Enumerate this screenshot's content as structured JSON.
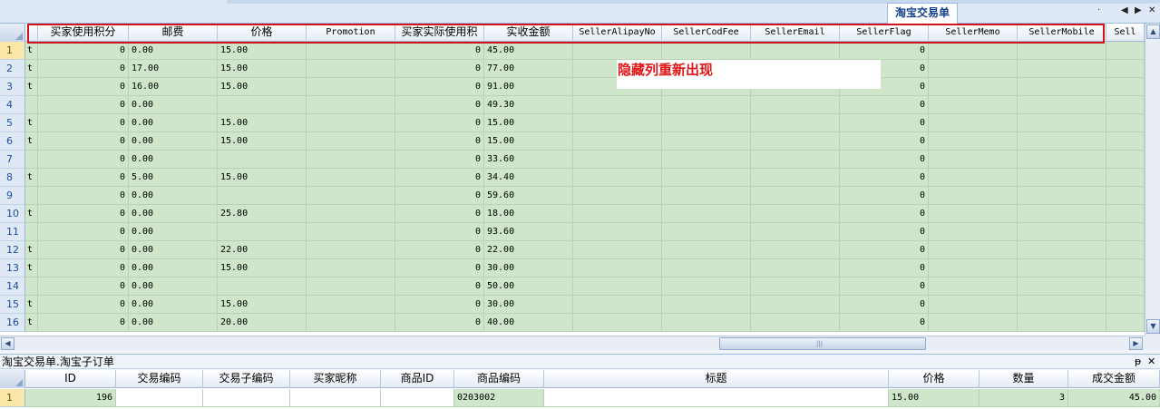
{
  "doc_tab": {
    "label": "淘宝交易单"
  },
  "main_grid": {
    "columns": [
      {
        "label": "买家使用积分",
        "kind": "cn"
      },
      {
        "label": "邮费",
        "kind": "cn"
      },
      {
        "label": "价格",
        "kind": "cn"
      },
      {
        "label": "Promotion",
        "kind": "en"
      },
      {
        "label": "买家实际使用积",
        "kind": "cn"
      },
      {
        "label": "实收金额",
        "kind": "cn"
      },
      {
        "label": "SellerAlipayNo",
        "kind": "en"
      },
      {
        "label": "SellerCodFee",
        "kind": "en"
      },
      {
        "label": "SellerEmail",
        "kind": "en"
      },
      {
        "label": "SellerFlag",
        "kind": "en"
      },
      {
        "label": "SellerMemo",
        "kind": "en"
      },
      {
        "label": "SellerMobile",
        "kind": "en"
      },
      {
        "label": "Sell",
        "kind": "en"
      }
    ],
    "rows": [
      {
        "num": "1",
        "flag": "t",
        "c": [
          "0",
          "0.00",
          "15.00",
          "",
          "0",
          "45.00",
          "",
          "",
          "",
          "0",
          "",
          "",
          ""
        ]
      },
      {
        "num": "2",
        "flag": "t",
        "c": [
          "0",
          "17.00",
          "15.00",
          "",
          "0",
          "77.00",
          "",
          "",
          "",
          "0",
          "",
          "",
          ""
        ]
      },
      {
        "num": "3",
        "flag": "t",
        "c": [
          "0",
          "16.00",
          "15.00",
          "",
          "0",
          "91.00",
          "",
          "",
          "",
          "0",
          "",
          "",
          ""
        ]
      },
      {
        "num": "4",
        "flag": "",
        "c": [
          "0",
          "0.00",
          "",
          "",
          "0",
          "49.30",
          "",
          "",
          "",
          "0",
          "",
          "",
          ""
        ]
      },
      {
        "num": "5",
        "flag": "t",
        "c": [
          "0",
          "0.00",
          "15.00",
          "",
          "0",
          "15.00",
          "",
          "",
          "",
          "0",
          "",
          "",
          ""
        ]
      },
      {
        "num": "6",
        "flag": "t",
        "c": [
          "0",
          "0.00",
          "15.00",
          "",
          "0",
          "15.00",
          "",
          "",
          "",
          "0",
          "",
          "",
          ""
        ]
      },
      {
        "num": "7",
        "flag": "",
        "c": [
          "0",
          "0.00",
          "",
          "",
          "0",
          "33.60",
          "",
          "",
          "",
          "0",
          "",
          "",
          ""
        ]
      },
      {
        "num": "8",
        "flag": "t",
        "c": [
          "0",
          "5.00",
          "15.00",
          "",
          "0",
          "34.40",
          "",
          "",
          "",
          "0",
          "",
          "",
          ""
        ]
      },
      {
        "num": "9",
        "flag": "",
        "c": [
          "0",
          "0.00",
          "",
          "",
          "0",
          "59.60",
          "",
          "",
          "",
          "0",
          "",
          "",
          ""
        ]
      },
      {
        "num": "10",
        "flag": "t",
        "c": [
          "0",
          "0.00",
          "25.80",
          "",
          "0",
          "18.00",
          "",
          "",
          "",
          "0",
          "",
          "",
          ""
        ]
      },
      {
        "num": "11",
        "flag": "",
        "c": [
          "0",
          "0.00",
          "",
          "",
          "0",
          "93.60",
          "",
          "",
          "",
          "0",
          "",
          "",
          ""
        ]
      },
      {
        "num": "12",
        "flag": "t",
        "c": [
          "0",
          "0.00",
          "22.00",
          "",
          "0",
          "22.00",
          "",
          "",
          "",
          "0",
          "",
          "",
          ""
        ]
      },
      {
        "num": "13",
        "flag": "t",
        "c": [
          "0",
          "0.00",
          "15.00",
          "",
          "0",
          "30.00",
          "",
          "",
          "",
          "0",
          "",
          "",
          ""
        ]
      },
      {
        "num": "14",
        "flag": "",
        "c": [
          "0",
          "0.00",
          "",
          "",
          "0",
          "50.00",
          "",
          "",
          "",
          "0",
          "",
          "",
          ""
        ]
      },
      {
        "num": "15",
        "flag": "t",
        "c": [
          "0",
          "0.00",
          "15.00",
          "",
          "0",
          "30.00",
          "",
          "",
          "",
          "0",
          "",
          "",
          ""
        ]
      },
      {
        "num": "16",
        "flag": "t",
        "c": [
          "0",
          "0.00",
          "20.00",
          "",
          "0",
          "40.00",
          "",
          "",
          "",
          "0",
          "",
          "",
          ""
        ]
      }
    ],
    "selected_row": "1"
  },
  "annotation": {
    "text": "隐藏列重新出现",
    "color": "#d0141c"
  },
  "detail_panel": {
    "title": "淘宝交易单.淘宝子订单",
    "pin_label": "ᵽ",
    "close_label": "✕",
    "columns": [
      "ID",
      "交易编码",
      "交易子编码",
      "买家昵称",
      "商品ID",
      "商品编码",
      "标题",
      "价格",
      "数量",
      "成交金额"
    ],
    "rows": [
      {
        "num": "1",
        "c": [
          "196",
          "",
          "",
          "",
          "",
          "0203002",
          "",
          "15.00",
          "3",
          "45.00"
        ]
      }
    ]
  },
  "scrollbars": {
    "up": "▲",
    "down": "▼",
    "left": "◀",
    "right": "▶",
    "grip": "|||"
  },
  "tab_nav": {
    "dot": "·",
    "prev": "◀",
    "next": "▶",
    "close": "✕"
  }
}
